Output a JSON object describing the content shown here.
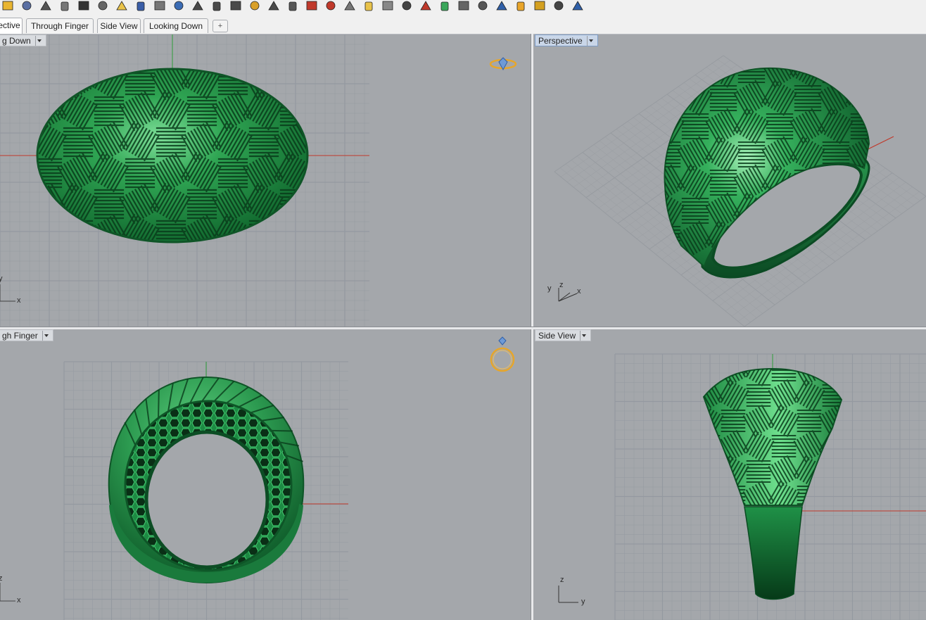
{
  "toolbar": {
    "icons": [
      "open-file-icon",
      "save-icon",
      "print-icon",
      "new-document-icon",
      "cut-icon",
      "copy-icon",
      "paste-icon",
      "undo-icon",
      "pan-icon",
      "rotate-view-icon",
      "zoom-icon",
      "zoom-window-icon",
      "zoom-extents-icon",
      "zoom-selected-icon",
      "zoom-target-icon",
      "four-viewports-icon",
      "car-icon",
      "set-cplane-icon",
      "undo-view-icon",
      "lock-icon",
      "light-icon",
      "render-icon",
      "materials-icon",
      "color-wheel-icon",
      "sphere-icon",
      "sphere-shaded-icon",
      "blue-sphere-icon",
      "wand-icon",
      "gear-icon",
      "dimension-icon",
      "help-icon"
    ]
  },
  "tabs": [
    {
      "label": "ective",
      "active": true
    },
    {
      "label": "Through Finger",
      "active": false
    },
    {
      "label": "Side View",
      "active": false
    },
    {
      "label": "Looking Down",
      "active": false
    }
  ],
  "tab_add_label": "+",
  "viewports": {
    "top_left": {
      "label": "g Down",
      "axis_x": "x",
      "axis_y": "y"
    },
    "top_right": {
      "label": "Perspective",
      "axis_x": "x",
      "axis_y": "y",
      "axis_z": "z"
    },
    "bottom_left": {
      "label": "gh Finger",
      "axis_x": "x",
      "axis_z": "z"
    },
    "bottom_right": {
      "label": "Side View",
      "axis_y": "y",
      "axis_z": "z"
    }
  },
  "colors": {
    "model_green": "#2e9a4f",
    "model_dark": "#0d5a2a",
    "x_axis": "#c0392b",
    "y_axis": "#2e9e3a",
    "grid": "#8f9397",
    "viewport_bg": "#a4a7ab",
    "gold": "#e7a62a"
  }
}
